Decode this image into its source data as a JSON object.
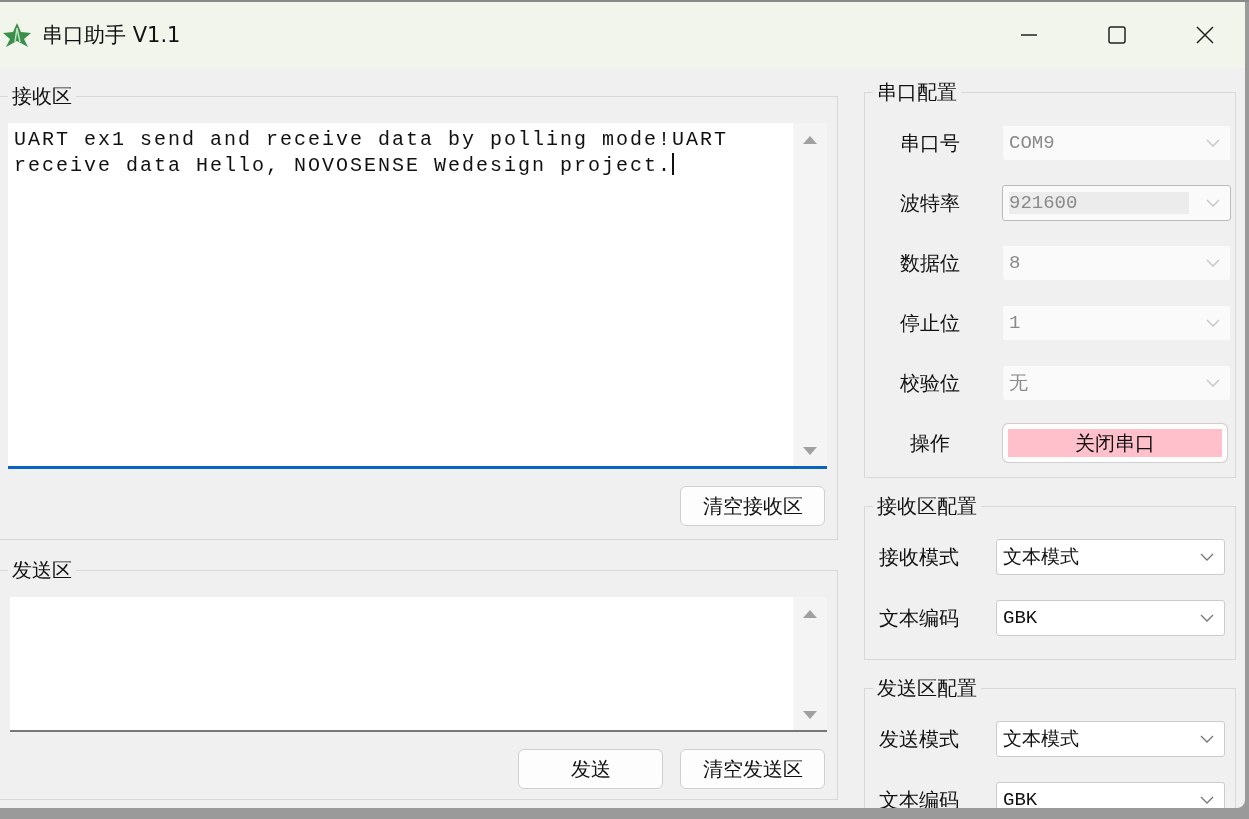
{
  "window": {
    "title": "串口助手 V1.1"
  },
  "receive_area": {
    "title": "接收区",
    "text": "UART ex1 send and receive data by polling mode!UART receive data Hello, NOVOSENSE Wedesign project.",
    "focused": true,
    "buttons": [
      {
        "label": "清空接收区"
      }
    ]
  },
  "send_area": {
    "title": "发送区",
    "focused": false,
    "buttons": [
      {
        "label": "发送"
      },
      {
        "label": "清空发送区"
      }
    ]
  },
  "serial_config": {
    "title": "串口配置",
    "fields": [
      {
        "label": "串口号",
        "value": "COM9",
        "disabled": true,
        "focused": false
      },
      {
        "label": "波特率",
        "value": "921600",
        "disabled": true,
        "focused": true
      },
      {
        "label": "数据位",
        "value": "8",
        "disabled": true,
        "focused": false
      },
      {
        "label": "停止位",
        "value": "1",
        "disabled": true,
        "focused": false
      },
      {
        "label": "校验位",
        "value": "无",
        "disabled": true,
        "focused": false
      }
    ],
    "action": {
      "label": "操作",
      "button": "关闭串口",
      "open": true
    }
  },
  "receive_config": {
    "title": "接收区配置",
    "fields": [
      {
        "label": "接收模式",
        "value": "文本模式",
        "disabled": false,
        "focused": false
      },
      {
        "label": "文本编码",
        "value": "GBK",
        "disabled": false,
        "focused": false
      }
    ]
  },
  "send_config": {
    "title": "发送区配置",
    "fields": [
      {
        "label": "发送模式",
        "value": "文本模式",
        "disabled": false,
        "focused": false
      },
      {
        "label": "文本编码",
        "value": "GBK",
        "disabled": false,
        "focused": false
      }
    ]
  }
}
